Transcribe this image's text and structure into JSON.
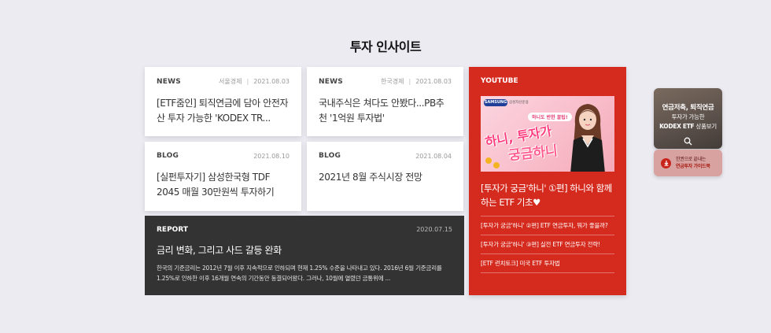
{
  "page": {
    "title": "투자 인사이트"
  },
  "cards": [
    {
      "category": "NEWS",
      "source": "서울경제",
      "date": "2021.08.03",
      "title": "[ETF줌인] 퇴직연금에 담아 안전자산 투자 가능한 'KODEX TR..."
    },
    {
      "category": "NEWS",
      "source": "한국경제",
      "date": "2021.08.03",
      "title": "국내주식은 쳐다도 안봤다...PB추천 '1억원 투자법'"
    },
    {
      "category": "BLOG",
      "date": "2021.08.10",
      "title": "[실펀투자기] 삼성한국형 TDF 2045 매월 30만원씩 투자하기"
    },
    {
      "category": "BLOG",
      "date": "2021.08.04",
      "title": "2021년 8월 주식시장 전망"
    }
  ],
  "report": {
    "category": "REPORT",
    "date": "2020.07.15",
    "title": "금리 변화, 그리고 사드 갈등 완화",
    "description": "한국의 기준금리는 2012년 7월 이후 지속적으로 인하되며 현재 1.25% 수준을 나타내고 있다. 2016년 6월 기준금리를 1.25%로 인하한 이후 16개월 연속의 기간동안 동결되어왔다. 그러나, 10월에 열렸던 금통위에 ..."
  },
  "youtube": {
    "category": "YOUTUBE",
    "thumbnail": {
      "logo": "SAMSUNG",
      "brand": "삼성자산운용",
      "bubble": "하니도 반한 꿀팁!",
      "big_line1": "하니, 투자가",
      "big_line2": "궁금하니"
    },
    "main_title": "[투자가 궁금'하니' ①편] 하니와 함께하는 ETF 기초♥",
    "items": [
      "[투자가 궁금'하니' ②편] ETF 연금투자, 뭐가 좋을까?",
      "[투자가 궁금'하니' ③편] 실전 ETF 연금투자 전략!",
      "[ETF 런치토크] 미국 ETF 투자법"
    ]
  },
  "promo": {
    "line1": "연금저축, 퇴직연금",
    "line2": "투자가 가능한",
    "line3_bold": "KODEX ETF",
    "line3_rest": " 상품보기",
    "icon": "search-icon"
  },
  "guide": {
    "line1": "한권으로 끝내는",
    "line2": "연금투자 가이드북",
    "icon": "download-icon"
  },
  "colors": {
    "background": "#ecebf2",
    "youtube_bg": "#d52a1e",
    "report_bg": "#333333"
  }
}
